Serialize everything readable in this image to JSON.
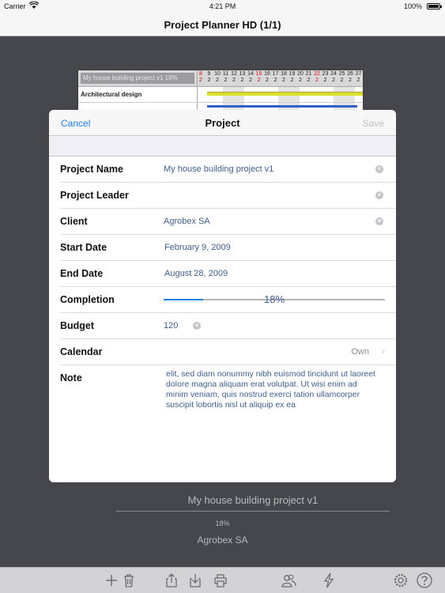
{
  "status_bar": {
    "carrier": "Carrier",
    "time": "4:21 PM",
    "battery": "100%"
  },
  "nav": {
    "title": "Project Planner HD (1/1)"
  },
  "gantt_preview": {
    "project_label": "My house building project v1  18%",
    "row_label": "Architectural design",
    "days": [
      "8",
      "9",
      "10",
      "11",
      "12",
      "13",
      "14",
      "15",
      "16",
      "17",
      "18",
      "19",
      "20",
      "21",
      "22",
      "23",
      "24",
      "25",
      "26",
      "27"
    ],
    "day_sub": "2",
    "red_days": [
      "8",
      "15",
      "22"
    ]
  },
  "modal": {
    "cancel": "Cancel",
    "title": "Project",
    "save": "Save",
    "fields": {
      "project_name": {
        "label": "Project Name",
        "value": "My house building project v1"
      },
      "project_leader": {
        "label": "Project Leader",
        "value": ""
      },
      "client": {
        "label": "Client",
        "value": "Agrobex SA"
      },
      "start_date": {
        "label": "Start Date",
        "value": "February 9, 2009"
      },
      "end_date": {
        "label": "End Date",
        "value": "August 28, 2009"
      },
      "completion": {
        "label": "Completion",
        "value": "18%",
        "fraction": 0.18
      },
      "budget": {
        "label": "Budget",
        "value": "120"
      },
      "calendar": {
        "label": "Calendar",
        "value": "Own"
      },
      "note": {
        "label": "Note",
        "value": "elit, sed diam nonummy nibh euismod tincidunt ut laoreet dolore magna aliquam erat volutpat. Ut wisi enim ad minim veniam, quis nostrud exerci tation ullamcorper suscipit lobortis nisl ut aliquip ex ea"
      }
    }
  },
  "summary": {
    "project": "My house building project v1",
    "completion": "18%",
    "client": "Agrobex SA"
  },
  "toolbar": {
    "icons": [
      "plus-icon",
      "trash-icon",
      "share-icon",
      "import-icon",
      "print-icon",
      "people-icon",
      "lightning-icon",
      "gear-icon",
      "help-icon"
    ]
  },
  "colors": {
    "accent": "#1a7ee8",
    "value_text": "#3d5f8f",
    "background": "#45474d"
  }
}
